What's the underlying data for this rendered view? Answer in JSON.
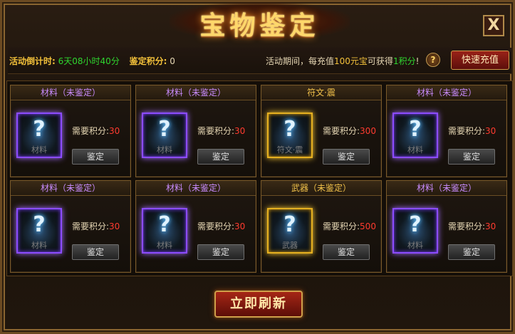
{
  "window": {
    "title": "宝物鉴定",
    "close_label": "X"
  },
  "info": {
    "countdown_label": "活动倒计时:",
    "countdown_value": "6天08小时40分",
    "score_label": "鉴定积分:",
    "score_value": "0",
    "event_text_1": "活动期间，每充值",
    "event_amount": "100元宝",
    "event_text_2": "可获得",
    "event_points": "1积分",
    "event_text_3": "!",
    "help_label": "?",
    "recharge_label": "快速充值"
  },
  "cards": [
    {
      "title": "材料（未鉴定）",
      "item_label": "材料",
      "need_label": "需要积分:",
      "cost": "30",
      "button": "鉴定",
      "quality": "purple"
    },
    {
      "title": "材料（未鉴定）",
      "item_label": "材料",
      "need_label": "需要积分:",
      "cost": "30",
      "button": "鉴定",
      "quality": "purple"
    },
    {
      "title": "符文·震",
      "item_label": "符文·震",
      "need_label": "需要积分:",
      "cost": "300",
      "button": "鉴定",
      "quality": "gold"
    },
    {
      "title": "材料（未鉴定）",
      "item_label": "材料",
      "need_label": "需要积分:",
      "cost": "30",
      "button": "鉴定",
      "quality": "purple"
    },
    {
      "title": "材料（未鉴定）",
      "item_label": "材料",
      "need_label": "需要积分:",
      "cost": "30",
      "button": "鉴定",
      "quality": "purple"
    },
    {
      "title": "材料（未鉴定）",
      "item_label": "材料",
      "need_label": "需要积分:",
      "cost": "30",
      "button": "鉴定",
      "quality": "purple"
    },
    {
      "title": "武器（未鉴定）",
      "item_label": "武器",
      "need_label": "需要积分:",
      "cost": "500",
      "button": "鉴定",
      "quality": "gold"
    },
    {
      "title": "材料（未鉴定）",
      "item_label": "材料",
      "need_label": "需要积分:",
      "cost": "30",
      "button": "鉴定",
      "quality": "purple"
    }
  ],
  "footer": {
    "refresh_label": "立即刷新"
  },
  "colors": {
    "gold_text": "#f3c13a",
    "green_text": "#2fd62f",
    "cost_red": "#ff3b2f",
    "purple_title": "#c98cff",
    "gold_title": "#f1c14a"
  }
}
